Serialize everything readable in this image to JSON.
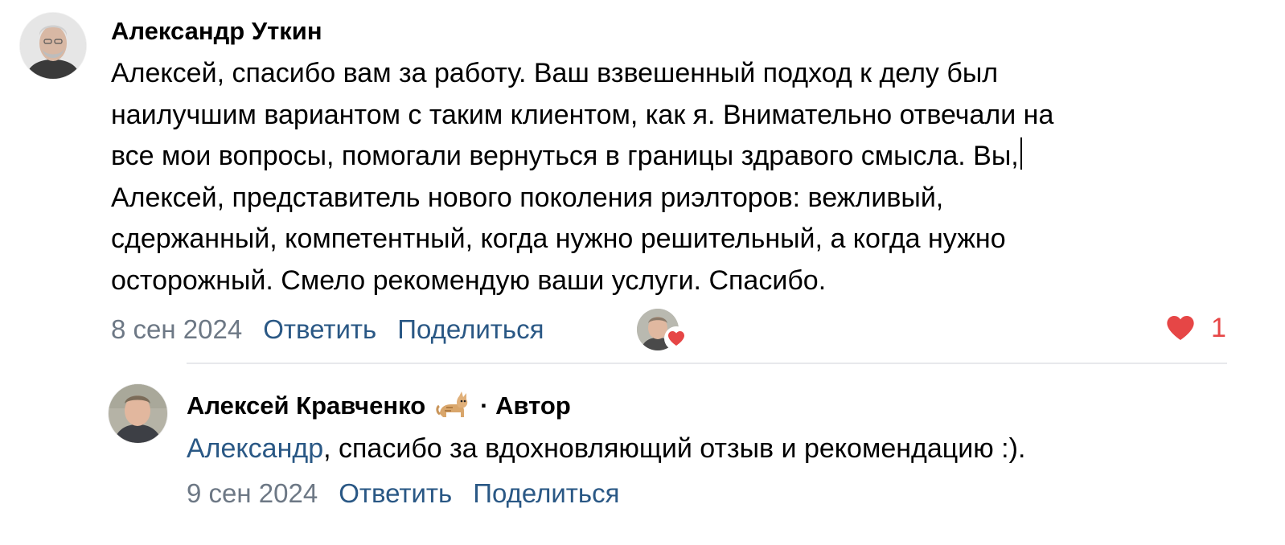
{
  "comments": [
    {
      "author": "Александр Уткин",
      "lines": [
        "Алексей, спасибо вам за работу. Ваш взвешенный подход к делу был",
        "наилучшим вариантом с таким клиентом, как я. Внимательно отвечали на",
        "все мои вопросы, помогали вернуться в границы здравого смысла. Вы,",
        "Алексей, представитель нового поколения риэлторов: вежливый,",
        "сдержанный, компетентный, когда нужно решительный, а когда нужно",
        "осторожный. Смело рекомендую ваши услуги. Спасибо."
      ],
      "date": "8 сен 2024",
      "reply_label": "Ответить",
      "share_label": "Поделиться",
      "like_count": "1"
    },
    {
      "author": "Алексей Кравченко",
      "author_icon": "cat-emoji-icon",
      "author_suffix": "· Автор",
      "mention": "Александр",
      "text": ", спасибо за вдохновляющий отзыв и рекомендацию :).",
      "date": "9 сен 2024",
      "reply_label": "Ответить",
      "share_label": "Поделиться"
    }
  ],
  "colors": {
    "link": "#2a5885",
    "meta": "#6d7885",
    "like": "#e64646",
    "divider": "#e7e8ec"
  }
}
